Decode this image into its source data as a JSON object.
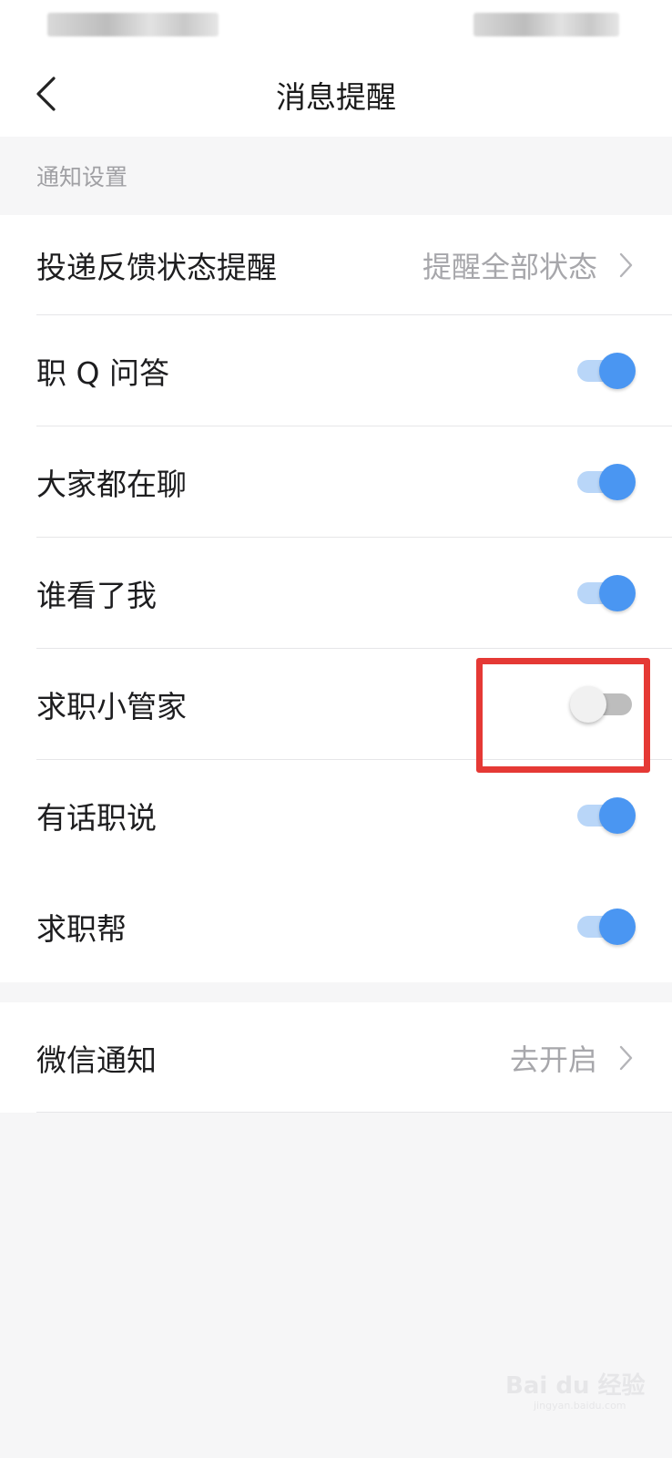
{
  "header": {
    "title": "消息提醒"
  },
  "section": {
    "label": "通知设置"
  },
  "notification_rows": [
    {
      "label": "投递反馈状态提醒",
      "value": "提醒全部状态"
    },
    {
      "label": "职 Q 问答",
      "enabled": true
    },
    {
      "label": "大家都在聊",
      "enabled": true
    },
    {
      "label": "谁看了我",
      "enabled": true
    },
    {
      "label": "求职小管家",
      "enabled": false
    },
    {
      "label": "有话职说",
      "enabled": true
    },
    {
      "label": "求职帮",
      "enabled": true
    }
  ],
  "wechat": {
    "label": "微信通知",
    "value": "去开启"
  },
  "watermark": {
    "brand": "Bai du 经验",
    "url": "jingyan.baidu.com"
  },
  "colors": {
    "accent": "#4a96f2",
    "highlight": "#e53935",
    "page_bg": "#f6f6f7"
  }
}
